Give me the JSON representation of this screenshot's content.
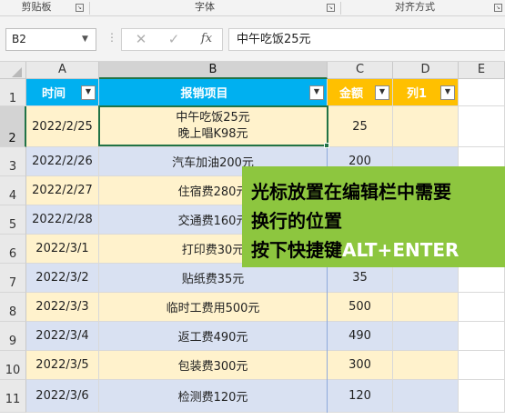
{
  "ribbon": {
    "groups": [
      "剪贴板",
      "字体",
      "对齐方式"
    ]
  },
  "formula_bar": {
    "name_box": "B2",
    "cancel_icon": "✕",
    "enter_icon": "✓",
    "fx_label": "fx",
    "formula": "中午吃饭25元"
  },
  "columns": [
    "A",
    "B",
    "C",
    "D",
    "E"
  ],
  "rows": [
    "1",
    "2",
    "3",
    "4",
    "5",
    "6",
    "7",
    "8",
    "9",
    "10",
    "11"
  ],
  "table": {
    "headers": {
      "time": "时间",
      "item": "报销项目",
      "amount": "金额",
      "col1": "列1"
    },
    "records": [
      {
        "date": "2022/2/25",
        "item_line1": "中午吃饭25元",
        "item_line2": "晚上唱K98元",
        "amount": "25"
      },
      {
        "date": "2022/2/26",
        "item": "汽车加油200元",
        "amount": "200"
      },
      {
        "date": "2022/2/27",
        "item": "住宿费280元",
        "amount": ""
      },
      {
        "date": "2022/2/28",
        "item": "交通费160元",
        "amount": ""
      },
      {
        "date": "2022/3/1",
        "item": "打印费30元",
        "amount": ""
      },
      {
        "date": "2022/3/2",
        "item": "贴纸费35元",
        "amount": "35"
      },
      {
        "date": "2022/3/3",
        "item": "临时工费用500元",
        "amount": "500"
      },
      {
        "date": "2022/3/4",
        "item": "返工费490元",
        "amount": "490"
      },
      {
        "date": "2022/3/5",
        "item": "包装费300元",
        "amount": "300"
      },
      {
        "date": "2022/3/6",
        "item": "检测费120元",
        "amount": "120"
      }
    ]
  },
  "tooltip": {
    "line1": "光标放置在编辑栏中需要",
    "line2": "换行的位置",
    "line3_prefix": "按下快捷键",
    "line3_key": "ALT+ENTER"
  },
  "colors": {
    "header_blue": "#00b0f0",
    "header_gold": "#ffc000",
    "band_yellow": "#fff2cc",
    "band_blue": "#d9e1f2",
    "selection_green": "#217346",
    "tooltip_green": "#8dc63f"
  }
}
